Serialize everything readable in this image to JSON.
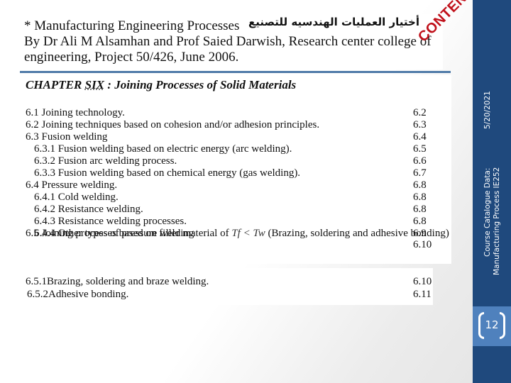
{
  "header": {
    "line1_prefix": "* Manufacturing Engineering Processes",
    "line1_arabic": "أختيار العمليات الهندسيه للتصنيع",
    "line2": "By Dr Ali M Alsamhan and Prof Saied Darwish, Research center college of",
    "line3": "engineering, Project 50/426, June 2006.",
    "stamp": "CONTENT"
  },
  "chapter": {
    "prefix": "CHAPTER ",
    "number": "SIX",
    "suffix": " :   Joining Processes of Solid Materials"
  },
  "toc": [
    {
      "label": "6.1 Joining technology.",
      "page": "6.2",
      "indent": 0
    },
    {
      "label": "6.2 Joining techniques based on cohesion and/or adhesion principles.",
      "page": "6.3",
      "indent": 0
    },
    {
      "label": "6.3 Fusion welding",
      "page": "6.4",
      "indent": 0
    },
    {
      "label": "6.3.1 Fusion welding based on electric energy (arc welding).",
      "page": "6.5",
      "indent": 1
    },
    {
      "label": "6.3.2 Fusion arc welding process.",
      "page": "6.6",
      "indent": 1
    },
    {
      "label": "6.3.3 Fusion welding based on chemical energy (gas welding).",
      "page": "6.7",
      "indent": 1
    },
    {
      "label": "6.4 Pressure welding.",
      "page": "6.8",
      "indent": 0
    },
    {
      "label": "6.4.1 Cold welding.",
      "page": "6.8",
      "indent": 1
    },
    {
      "label": "6.4.2 Resistance welding.",
      "page": "6.8",
      "indent": 1
    },
    {
      "label": "6.4.3 Resistance welding processes.",
      "page": "6.8",
      "indent": 1
    },
    {
      "label": "6.4.4 Other types of pressure welding",
      "page": "6.9",
      "indent": 1
    }
  ],
  "toc_65": {
    "label_before": "6.5 Joining processes based on filler material of ",
    "math": "Tf < Tw",
    "label_after": " (Brazing, soldering and adhesive bonding)",
    "page": "6.10"
  },
  "toc_sub": [
    {
      "label": "6.5.1Brazing, soldering and braze welding.",
      "page": "6.10"
    },
    {
      "label": "6.5.2Adhesive bonding.",
      "page": "6.11"
    }
  ],
  "sidebar": {
    "date": "5/20/2021",
    "course_line1": "Course Catalogue Data:",
    "course_line2": "Manufacturing Process IE252",
    "page_number": "12",
    "color": "#1f497d",
    "page_box_color": "#4f81bd"
  }
}
